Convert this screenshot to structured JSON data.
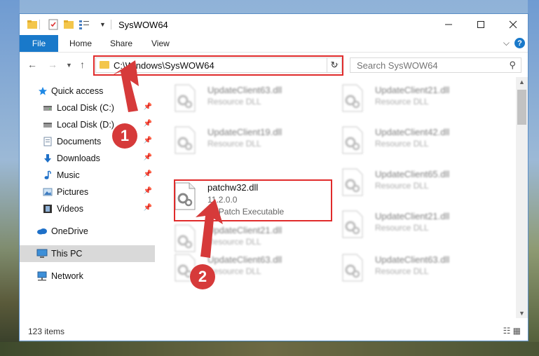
{
  "window": {
    "title": "SysWOW64"
  },
  "ribbon": {
    "file": "File",
    "home": "Home",
    "share": "Share",
    "view": "View",
    "help": "?"
  },
  "address": {
    "path": "C:\\Windows\\SysWOW64",
    "dropdown": "⌵",
    "refresh": "↻"
  },
  "search": {
    "placeholder": "Search SysWOW64"
  },
  "sidebar": {
    "items": [
      {
        "label": "Quick access",
        "icon": "star-icon",
        "color": "#1e88e5"
      },
      {
        "label": "Local Disk (C:)",
        "icon": "drive-icon",
        "pinned": true
      },
      {
        "label": "Local Disk (D:)",
        "icon": "drive-icon",
        "pinned": true
      },
      {
        "label": "Documents",
        "icon": "documents-icon",
        "pinned": true
      },
      {
        "label": "Downloads",
        "icon": "downloads-icon",
        "pinned": true
      },
      {
        "label": "Music",
        "icon": "music-icon",
        "pinned": true
      },
      {
        "label": "Pictures",
        "icon": "pictures-icon",
        "pinned": true
      },
      {
        "label": "Videos",
        "icon": "videos-icon",
        "pinned": true
      },
      {
        "label": "OneDrive",
        "icon": "onedrive-icon"
      },
      {
        "label": "This PC",
        "icon": "this-pc-icon",
        "selected": true
      },
      {
        "label": "Network",
        "icon": "network-icon"
      }
    ]
  },
  "files": [
    {
      "name": "UpdateClient63.dll",
      "type": "Resource DLL",
      "blurred": true
    },
    {
      "name": "UpdateClient21.dll",
      "type": "Resource DLL",
      "blurred": true
    },
    {
      "name": "UpdateClient19.dll",
      "type": "Resource DLL",
      "blurred": true
    },
    {
      "name": "UpdateClient42.dll",
      "type": "Resource DLL",
      "blurred": true
    },
    {
      "name": "patchw32.dll",
      "version": "11.2.0.0",
      "type": "RTPatch Executable",
      "blurred": false
    },
    {
      "name": "UpdateClient65.dll",
      "type": "Resource DLL",
      "blurred": true
    },
    {
      "name": "UpdateClient21.dll",
      "type": "Resource DLL",
      "blurred": true
    },
    {
      "name": "UpdateClient21.dll",
      "type": "Resource DLL",
      "blurred": true
    },
    {
      "name": "UpdateClient63.dll",
      "type": "Resource DLL",
      "blurred": true
    },
    {
      "name": "UpdateClient63.dll",
      "type": "Resource DLL",
      "blurred": true
    }
  ],
  "status": {
    "count": "123 items"
  },
  "annotations": {
    "step1": "1",
    "step2": "2",
    "highlight_color": "#e02b2b"
  }
}
